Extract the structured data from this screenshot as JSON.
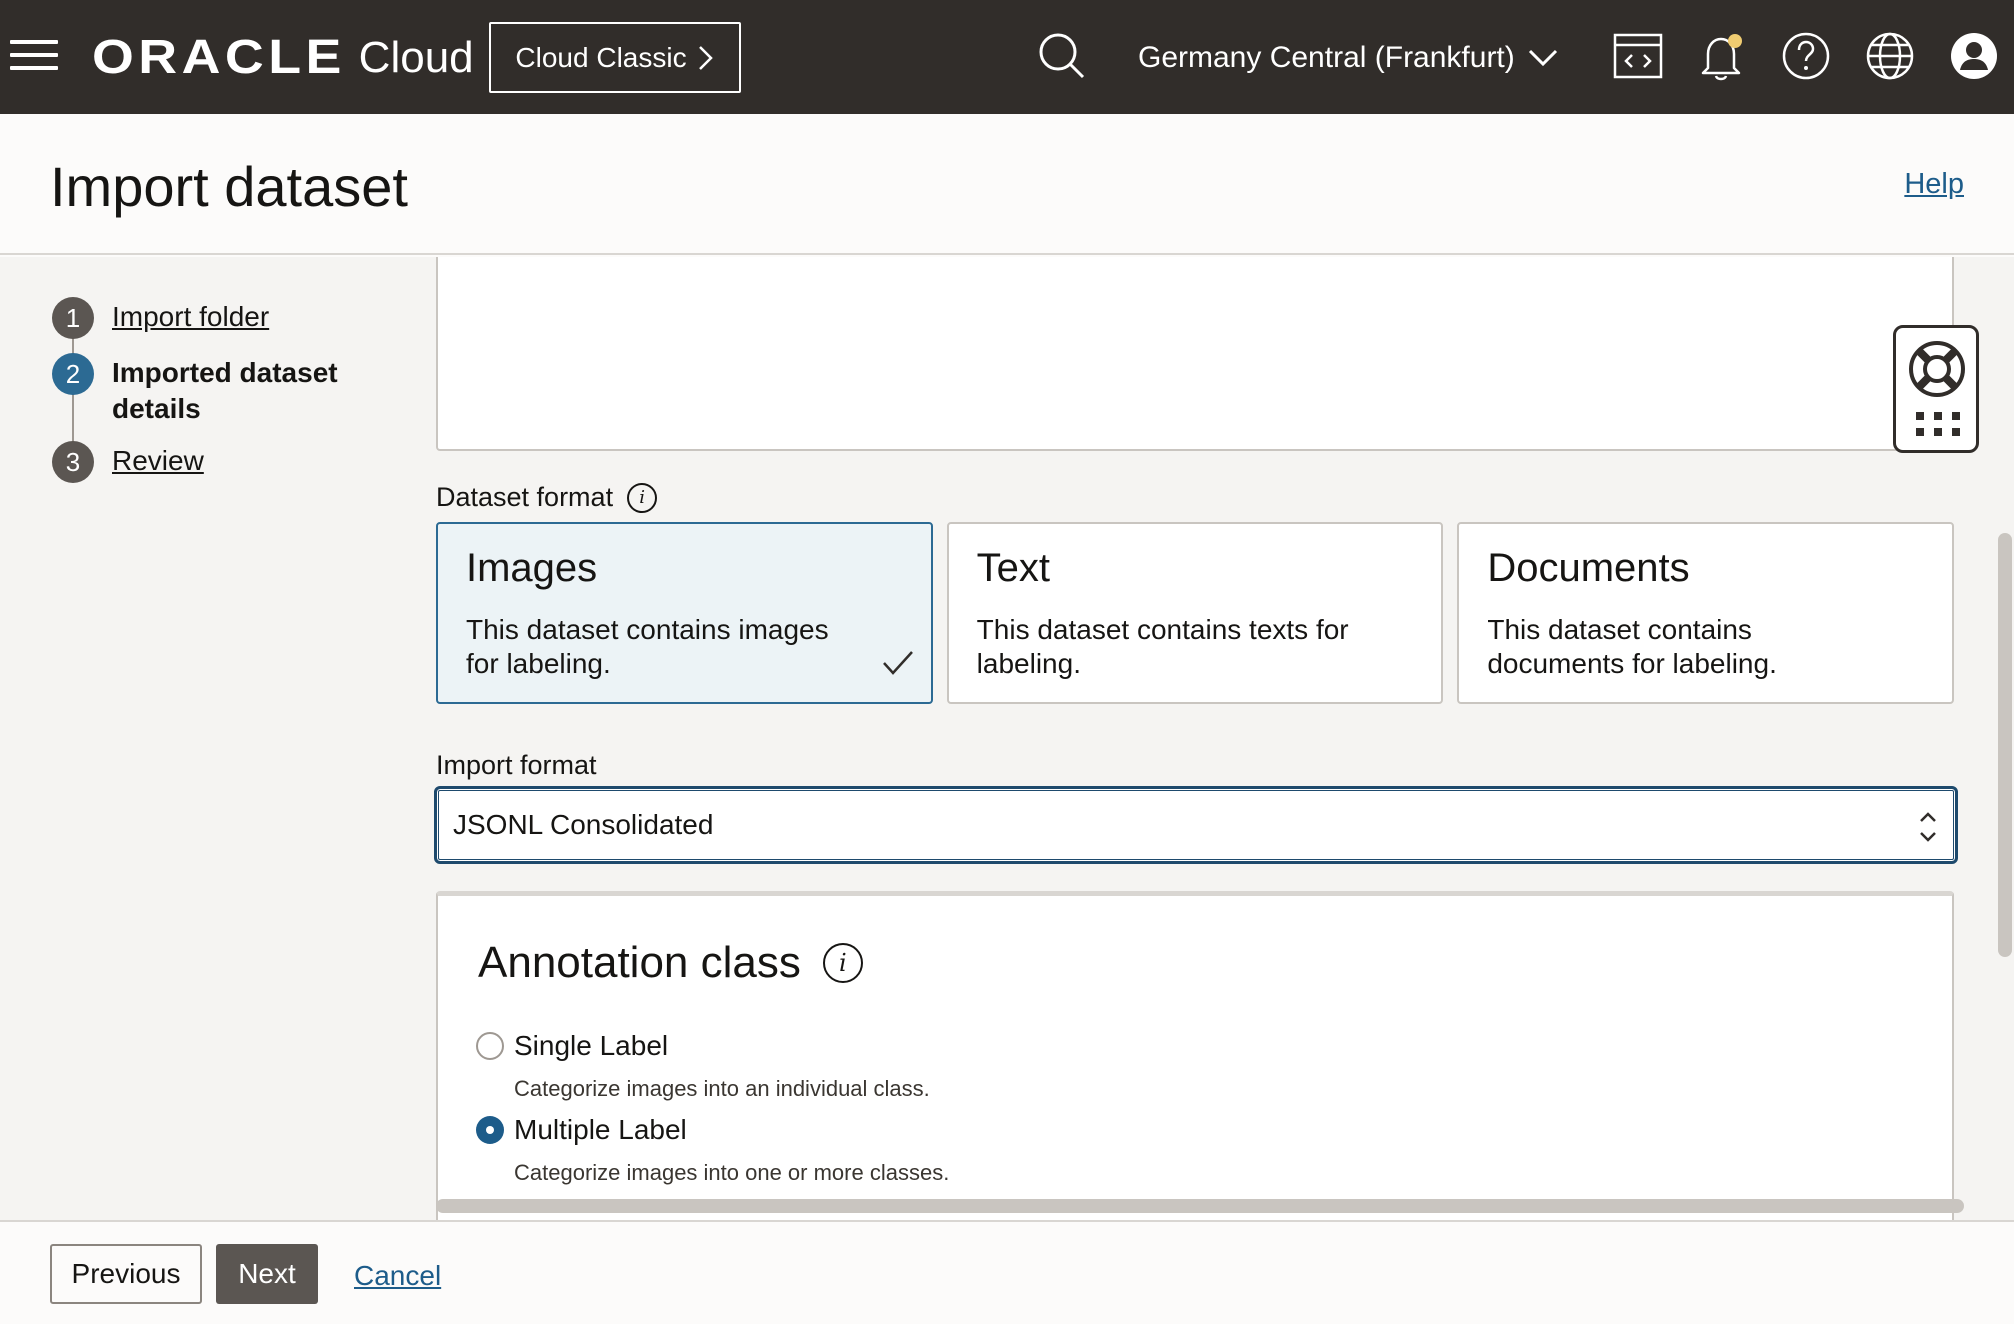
{
  "topbar": {
    "brand_oracle": "ORACLE",
    "brand_cloud": "Cloud",
    "cloud_classic_label": "Cloud Classic",
    "region": "Germany Central (Frankfurt)"
  },
  "header": {
    "title": "Import dataset",
    "help_label": "Help"
  },
  "steps": [
    {
      "number": "1",
      "label": "Import folder",
      "state": "link"
    },
    {
      "number": "2",
      "label": "Imported dataset details",
      "state": "current"
    },
    {
      "number": "3",
      "label": "Review",
      "state": "link"
    }
  ],
  "dataset_format": {
    "label": "Dataset format",
    "options": [
      {
        "title": "Images",
        "description": "This dataset contains images for labeling.",
        "selected": true
      },
      {
        "title": "Text",
        "description": "This dataset contains texts for labeling.",
        "selected": false
      },
      {
        "title": "Documents",
        "description": "This dataset contains documents for labeling.",
        "selected": false
      }
    ]
  },
  "import_format": {
    "label": "Import format",
    "value": "JSONL Consolidated"
  },
  "annotation_class": {
    "title": "Annotation class",
    "options": [
      {
        "label": "Single Label",
        "description": "Categorize images into an individual class.",
        "checked": false
      },
      {
        "label": "Multiple Label",
        "description": "Categorize images into one or more classes.",
        "checked": true
      }
    ]
  },
  "footer": {
    "previous_label": "Previous",
    "next_label": "Next",
    "cancel_label": "Cancel"
  },
  "colors": {
    "topbar_bg": "#312d2a",
    "accent": "#2c6a93",
    "link": "#1d5c8a",
    "notification_dot": "#f0cc71"
  }
}
